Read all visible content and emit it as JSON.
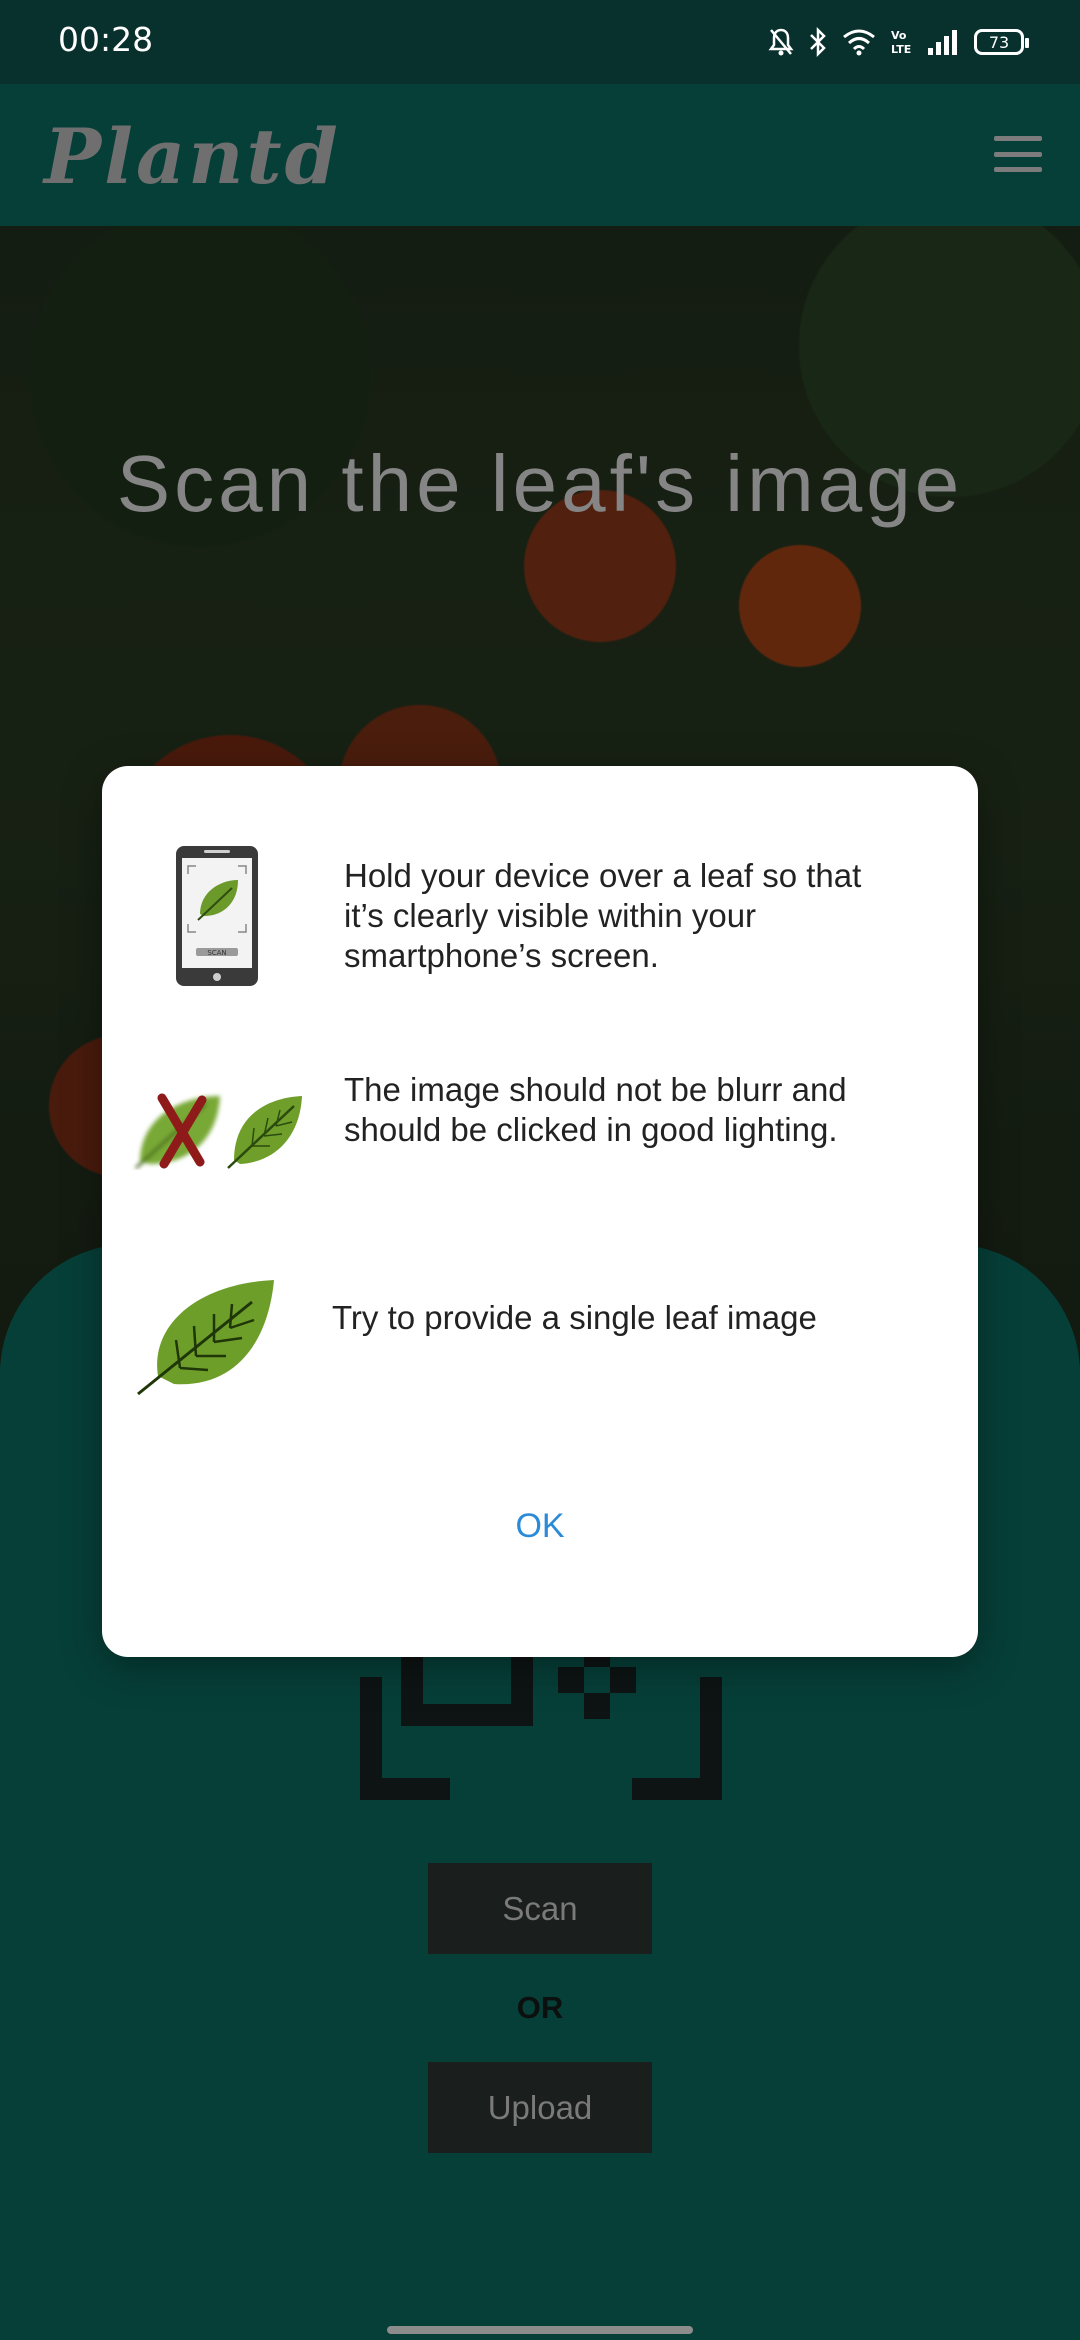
{
  "status_bar": {
    "time": "00:28",
    "battery": "73",
    "icons": [
      "mute-bell-icon",
      "bluetooth-icon",
      "wifi-icon",
      "volte-icon",
      "signal-icon",
      "battery-icon"
    ]
  },
  "app_bar": {
    "title": "Plantd",
    "menu_icon": "hamburger-menu-icon"
  },
  "hero": {
    "title": "Scan the leaf's image"
  },
  "dialog": {
    "tips": [
      {
        "icon": "phone-scan-icon",
        "text": "Hold your device over a leaf so that it’s clearly visible within your smartphone’s screen."
      },
      {
        "icon": "blurry-vs-clear-leaf-icon",
        "text": "The image should not be blurr and should be clicked in good lighting."
      },
      {
        "icon": "single-leaf-icon",
        "text": "Try to provide  a single leaf image"
      }
    ],
    "phone_label": "SCAN",
    "ok_label": "OK"
  },
  "main": {
    "scan_label": "Scan",
    "or_label": "OR",
    "upload_label": "Upload"
  },
  "colors": {
    "primary": "#063f38",
    "status_bar": "#08302d",
    "ok_blue": "#2b8bd8",
    "button_dark": "#1a1e1d"
  }
}
